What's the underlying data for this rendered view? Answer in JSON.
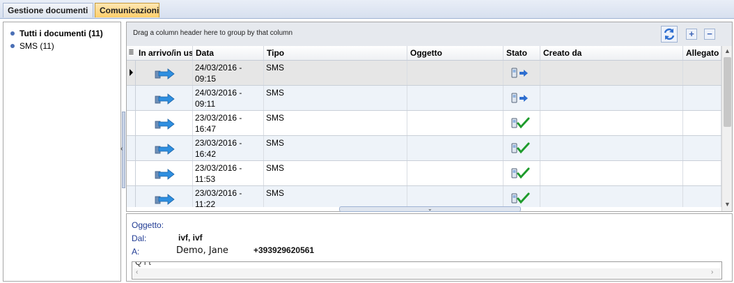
{
  "tabs": [
    {
      "label": "Gestione documenti"
    },
    {
      "label": "Comunicazioni"
    }
  ],
  "tree": {
    "items": [
      {
        "label": "Tutti i documenti (11)"
      },
      {
        "label": "SMS (11)"
      }
    ]
  },
  "grid": {
    "group_hint": "Drag a column header here to group by that column",
    "columns": [
      "In arrivo/in us",
      "Data",
      "Tipo",
      "Oggetto",
      "Stato",
      "Creato da",
      "Allegato"
    ],
    "rows": [
      {
        "direction_icon": "outgoing-arrow-icon",
        "date": "24/03/2016 -",
        "time": "09:15",
        "type": "SMS",
        "subject": "",
        "status_icon": "sms-sending-icon",
        "created_by": "",
        "attachment": ""
      },
      {
        "direction_icon": "outgoing-arrow-icon",
        "date": "24/03/2016 -",
        "time": "09:11",
        "type": "SMS",
        "subject": "",
        "status_icon": "sms-sending-icon",
        "created_by": "",
        "attachment": ""
      },
      {
        "direction_icon": "outgoing-arrow-icon",
        "date": "23/03/2016 -",
        "time": "16:47",
        "type": "SMS",
        "subject": "",
        "status_icon": "sms-delivered-icon",
        "created_by": "",
        "attachment": ""
      },
      {
        "direction_icon": "outgoing-arrow-icon",
        "date": "23/03/2016 -",
        "time": "16:42",
        "type": "SMS",
        "subject": "",
        "status_icon": "sms-delivered-icon",
        "created_by": "",
        "attachment": ""
      },
      {
        "direction_icon": "outgoing-arrow-icon",
        "date": "23/03/2016 -",
        "time": "11:53",
        "type": "SMS",
        "subject": "",
        "status_icon": "sms-delivered-icon",
        "created_by": "",
        "attachment": ""
      },
      {
        "direction_icon": "outgoing-arrow-icon",
        "date": "23/03/2016 -",
        "time": "11:22",
        "type": "SMS",
        "subject": "",
        "status_icon": "sms-delivered-icon",
        "created_by": "",
        "attachment": ""
      }
    ]
  },
  "detail": {
    "subject_label": "Oggetto:",
    "from_label": "Dal:",
    "from_value": "ivf, ivf",
    "to_label": "A:",
    "to_name": "Demo, Jane",
    "to_number": "+393929620561",
    "body_preview": "Q         f                    t      "
  },
  "colors": {
    "tab_active": "#ffcf6b",
    "label_blue": "#1f3a93",
    "row_alt": "#eef3f9",
    "arrow_blue": "#2f8fe0",
    "check_green": "#1e9b2c"
  }
}
